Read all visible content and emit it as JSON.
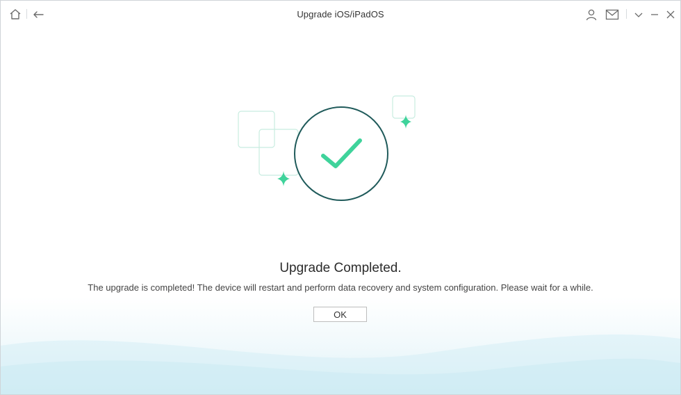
{
  "titlebar": {
    "title": "Upgrade iOS/iPadOS",
    "left_icons": [
      "home-icon",
      "back-arrow-icon"
    ],
    "right_icons": [
      "user-icon",
      "mail-icon",
      "chevron-down-icon",
      "minimize-icon",
      "close-icon"
    ]
  },
  "result": {
    "heading": "Upgrade Completed.",
    "message": "The upgrade is completed! The device will restart and perform data recovery and system configuration. Please wait for a while.",
    "ok_label": "OK"
  },
  "colors": {
    "accent_green": "#3fd39b",
    "circle_stroke": "#1f5a5a",
    "frame_stroke": "#bfe9dc"
  }
}
